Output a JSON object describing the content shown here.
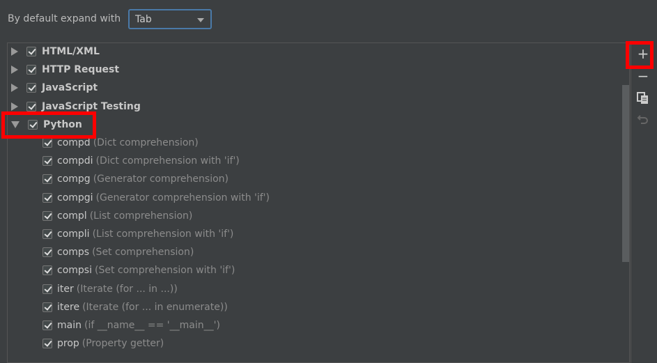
{
  "header": {
    "label": "By default expand with",
    "expand_key": "Tab"
  },
  "groups": [
    {
      "label": "HTML/XML",
      "expanded": false,
      "checked": true
    },
    {
      "label": "HTTP Request",
      "expanded": false,
      "checked": true
    },
    {
      "label": "JavaScript",
      "expanded": false,
      "checked": true
    },
    {
      "label": "JavaScript Testing",
      "expanded": false,
      "checked": true
    },
    {
      "label": "Python",
      "expanded": true,
      "checked": true
    }
  ],
  "python_templates": [
    {
      "abbr": "compd",
      "desc": "(Dict comprehension)"
    },
    {
      "abbr": "compdi",
      "desc": "(Dict comprehension with 'if')"
    },
    {
      "abbr": "compg",
      "desc": "(Generator comprehension)"
    },
    {
      "abbr": "compgi",
      "desc": "(Generator comprehension with 'if')"
    },
    {
      "abbr": "compl",
      "desc": "(List comprehension)"
    },
    {
      "abbr": "compli",
      "desc": "(List comprehension with 'if')"
    },
    {
      "abbr": "comps",
      "desc": "(Set comprehension)"
    },
    {
      "abbr": "compsi",
      "desc": "(Set comprehension with 'if')"
    },
    {
      "abbr": "iter",
      "desc": "(Iterate (for ... in ...))"
    },
    {
      "abbr": "itere",
      "desc": "(Iterate (for ... in enumerate))"
    },
    {
      "abbr": "main",
      "desc": "(if __name__ == '__main__')"
    },
    {
      "abbr": "prop",
      "desc": "(Property getter)"
    }
  ],
  "toolbar": {
    "add": "+",
    "remove": "−",
    "copy": "copy-icon",
    "restore": "undo-icon"
  },
  "highlight_color": "#ff0000"
}
